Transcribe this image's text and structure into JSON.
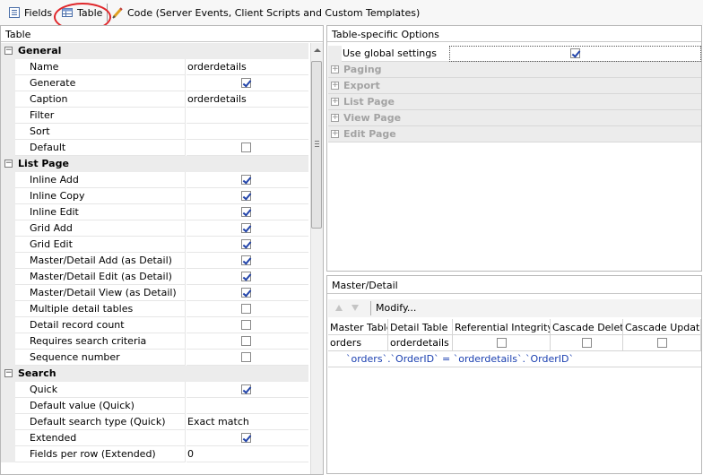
{
  "toolbar": {
    "tabs": [
      {
        "label": "Fields",
        "icon": "fields-list-icon"
      },
      {
        "label": "Table",
        "icon": "table-icon"
      },
      {
        "label": "Code (Server Events, Client Scripts and Custom Templates)",
        "icon": "code-pencil-icon"
      }
    ]
  },
  "left_panel": {
    "title": "Table",
    "categories": [
      {
        "label": "General",
        "expander": "−",
        "props": [
          {
            "name": "Name",
            "value": "orderdetails"
          },
          {
            "name": "Generate",
            "checked": true
          },
          {
            "name": "Caption",
            "value": "orderdetails"
          },
          {
            "name": "Filter",
            "value": ""
          },
          {
            "name": "Sort",
            "value": ""
          },
          {
            "name": "Default",
            "checked": false
          }
        ]
      },
      {
        "label": "List Page",
        "expander": "−",
        "props": [
          {
            "name": "Inline Add",
            "checked": true
          },
          {
            "name": "Inline Copy",
            "checked": true
          },
          {
            "name": "Inline Edit",
            "checked": true
          },
          {
            "name": "Grid Add",
            "checked": true
          },
          {
            "name": "Grid Edit",
            "checked": true
          },
          {
            "name": "Master/Detail Add (as Detail)",
            "checked": true
          },
          {
            "name": "Master/Detail Edit (as Detail)",
            "checked": true
          },
          {
            "name": "Master/Detail View (as Detail)",
            "checked": true
          },
          {
            "name": "Multiple detail tables",
            "checked": false
          },
          {
            "name": "Detail record count",
            "checked": false
          },
          {
            "name": "Requires search criteria",
            "checked": false
          },
          {
            "name": "Sequence number",
            "checked": false
          }
        ]
      },
      {
        "label": "Search",
        "expander": "−",
        "props": [
          {
            "name": "Quick",
            "checked": true
          },
          {
            "name": "Default value (Quick)",
            "value": ""
          },
          {
            "name": "Default search type (Quick)",
            "value": "Exact match"
          },
          {
            "name": "Extended",
            "checked": true
          },
          {
            "name": "Fields per row (Extended)",
            "value": "0"
          }
        ]
      }
    ]
  },
  "options_panel": {
    "title": "Table-specific Options",
    "global_label": "Use global settings",
    "global_checked": true,
    "sections": [
      {
        "label": "Paging",
        "expander": "+"
      },
      {
        "label": "Export",
        "expander": "+"
      },
      {
        "label": "List Page",
        "expander": "+"
      },
      {
        "label": "View Page",
        "expander": "+"
      },
      {
        "label": "Edit Page",
        "expander": "+"
      }
    ]
  },
  "master_detail": {
    "title": "Master/Detail",
    "modify_label": "Modify...",
    "columns": [
      "Master Table",
      "Detail Table",
      "Referential Integrity",
      "Cascade Delete",
      "Cascade Update"
    ],
    "row": {
      "master": "orders",
      "detail": "orderdetails",
      "ref_integrity": false,
      "cascade_delete": false,
      "cascade_update": false
    },
    "relation": "`orders`.`OrderID` = `orderdetails`.`OrderID`"
  },
  "colors": {
    "highlight": "#e0262a",
    "relation_text": "#1a3fb0",
    "disabled_text": "#a3a3a3"
  }
}
